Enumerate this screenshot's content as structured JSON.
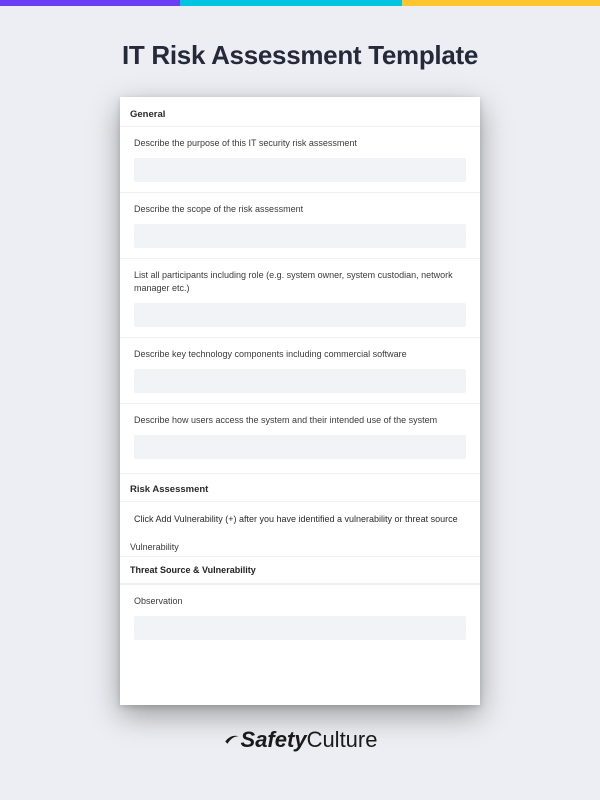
{
  "title": "IT Risk Assessment Template",
  "sections": {
    "general": {
      "heading": "General",
      "fields": [
        {
          "label": "Describe the purpose of this IT security risk assessment"
        },
        {
          "label": "Describe the scope of the risk assessment"
        },
        {
          "label": "List all participants including role (e.g. system owner, system custodian, network manager etc.)"
        },
        {
          "label": "Describe key technology components including commercial software"
        },
        {
          "label": "Describe how users access the system and their intended use of the system"
        }
      ]
    },
    "risk": {
      "heading": "Risk Assessment",
      "hint": "Click Add Vulnerability (+) after you have identified a vulnerability or threat source",
      "sub1": "Vulnerability",
      "sub2": "Threat Source & Vulnerability",
      "fields": [
        {
          "label": "Observation"
        }
      ]
    }
  },
  "brand": {
    "part1": "Safety",
    "part2": "Culture"
  }
}
